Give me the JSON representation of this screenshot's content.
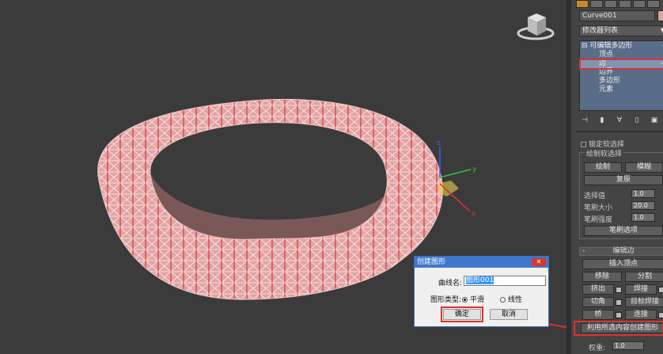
{
  "panel": {
    "object_name": "Curve001",
    "modifier_list": "修改器列表",
    "stack": {
      "root": "可编辑多边形",
      "items": [
        "顶点",
        "边",
        "边界",
        "多边形",
        "元素"
      ],
      "selected_index": 1
    },
    "lock_selection": "锁定软选择",
    "paint_group": {
      "title": "绘制软选择",
      "paint": "绘制",
      "blur": "模糊",
      "revert": "复原",
      "selection_value_label": "选择值",
      "selection_value": "1.0",
      "brush_size_label": "笔刷大小",
      "brush_size": "20.0",
      "brush_strength_label": "笔刷强度",
      "brush_strength": "1.0",
      "brush_options": "笔刷选项"
    },
    "edit_edges": {
      "toggle": "-",
      "title": "编辑边",
      "insert_vertex": "插入顶点",
      "remove": "移除",
      "split": "分割",
      "extrude": "挤出",
      "weld": "焊接",
      "chamfer": "切角",
      "target_weld": "目标焊接",
      "bridge": "桥",
      "connect": "连接",
      "create_shape": "利用所选内容创建图形",
      "weight_label": "权重:",
      "weight_value": "1.0"
    }
  },
  "dialog": {
    "title": "创建图形",
    "close": "✕",
    "curve_name_label": "曲线名:",
    "curve_name_value": "图形001",
    "shape_type_label": "图形类型:",
    "smooth_label": "平滑",
    "linear_label": "线性",
    "ok": "确定",
    "cancel": "取消"
  },
  "colors": {
    "highlight_red": "#e03030",
    "mesh_fill": "#e3a2a2",
    "dialog_title": "#3f77cf"
  }
}
